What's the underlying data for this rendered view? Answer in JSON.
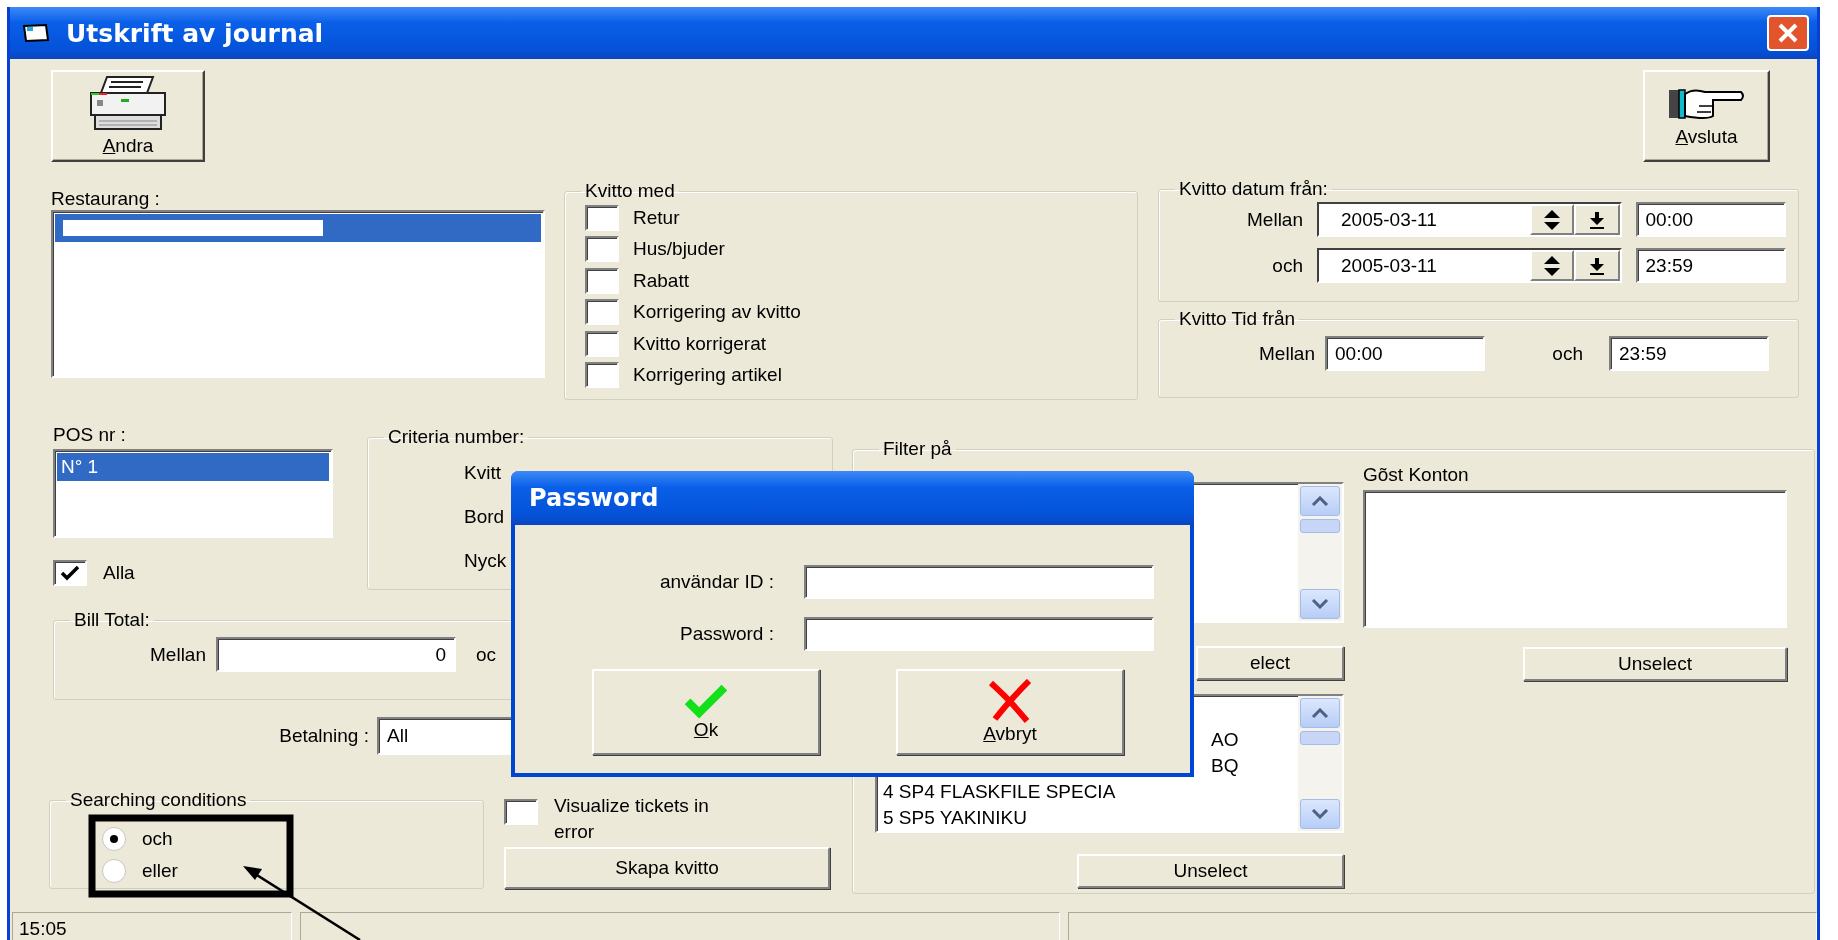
{
  "window": {
    "title": "Utskrift av journal"
  },
  "toolbar": [
    {
      "kind": "print",
      "label": "Andra",
      "access_key_first": true
    },
    {
      "kind": "exit",
      "label": "Avsluta",
      "access_key_first": true
    }
  ],
  "restaurang": {
    "label": "Restaurang :",
    "items": [
      {
        "redacted": true,
        "selected": true
      }
    ]
  },
  "kvitto_med": {
    "title": "Kvitto med",
    "options": [
      {
        "label": "Retur",
        "checked": false
      },
      {
        "label": "Hus/bjuder",
        "checked": false
      },
      {
        "label": "Rabatt",
        "checked": false
      },
      {
        "label": "Korrigering av kvitto",
        "checked": false
      },
      {
        "label": "Kvitto korrigerat",
        "checked": false
      },
      {
        "label": "Korrigering artikel",
        "checked": false
      }
    ]
  },
  "kvitto_datum": {
    "title": "Kvitto datum från:",
    "rows": [
      {
        "label": "Mellan",
        "date": "2005-03-11",
        "time": "00:00"
      },
      {
        "label": "och",
        "date": "2005-03-11",
        "time": "23:59"
      }
    ]
  },
  "kvitto_tid": {
    "title": "Kvitto Tid från",
    "from_label": "Mellan",
    "from": "00:00",
    "to_label": "och",
    "to": "23:59"
  },
  "pos": {
    "label": "POS nr :",
    "items": [
      {
        "text": "N° 1",
        "selected": true
      }
    ],
    "all": {
      "label": "Alla",
      "checked": true
    }
  },
  "criteria": {
    "title": "Criteria number:",
    "labels": [
      "Kvitt",
      "Bord",
      "Nyck"
    ]
  },
  "bill_total": {
    "title": "Bill Total:",
    "from_label": "Mellan",
    "from": "0",
    "to_label": "oc"
  },
  "betalning": {
    "label": "Betalning :",
    "value": "All"
  },
  "searching_conditions": {
    "title": "Searching conditions",
    "options": [
      {
        "label": "och",
        "selected": true
      },
      {
        "label": "eller",
        "selected": false
      }
    ]
  },
  "visualize_errors": {
    "label": "Visualize tickets in error",
    "checked": false
  },
  "create_button": "Skapa kvitto",
  "filter": {
    "title": "Filter på",
    "list_1": {
      "unselect": "elect"
    },
    "list_2": {
      "items": [
        {
          "text": "AO",
          "kind": "partial"
        },
        {
          "text": "BQ",
          "kind": "partial"
        },
        {
          "text": "4 SP4 FLASKFILE SPECIA",
          "kind": "full"
        },
        {
          "text": "5 SP5 YAKINIKU",
          "kind": "full"
        }
      ],
      "unselect": "Unselect"
    },
    "guest_accounts": {
      "label": "Gõst Konton",
      "unselect": "Unselect"
    }
  },
  "status_bar": {
    "time": "15:05"
  },
  "password_dialog": {
    "title": "Password",
    "fields": [
      {
        "label": "användar ID :"
      },
      {
        "label": "Password :"
      }
    ],
    "buttons": [
      {
        "kind": "ok",
        "label": "Ok",
        "access_key_first": true
      },
      {
        "kind": "cancel",
        "label": "Avbryt",
        "access_key_first": true
      }
    ]
  }
}
